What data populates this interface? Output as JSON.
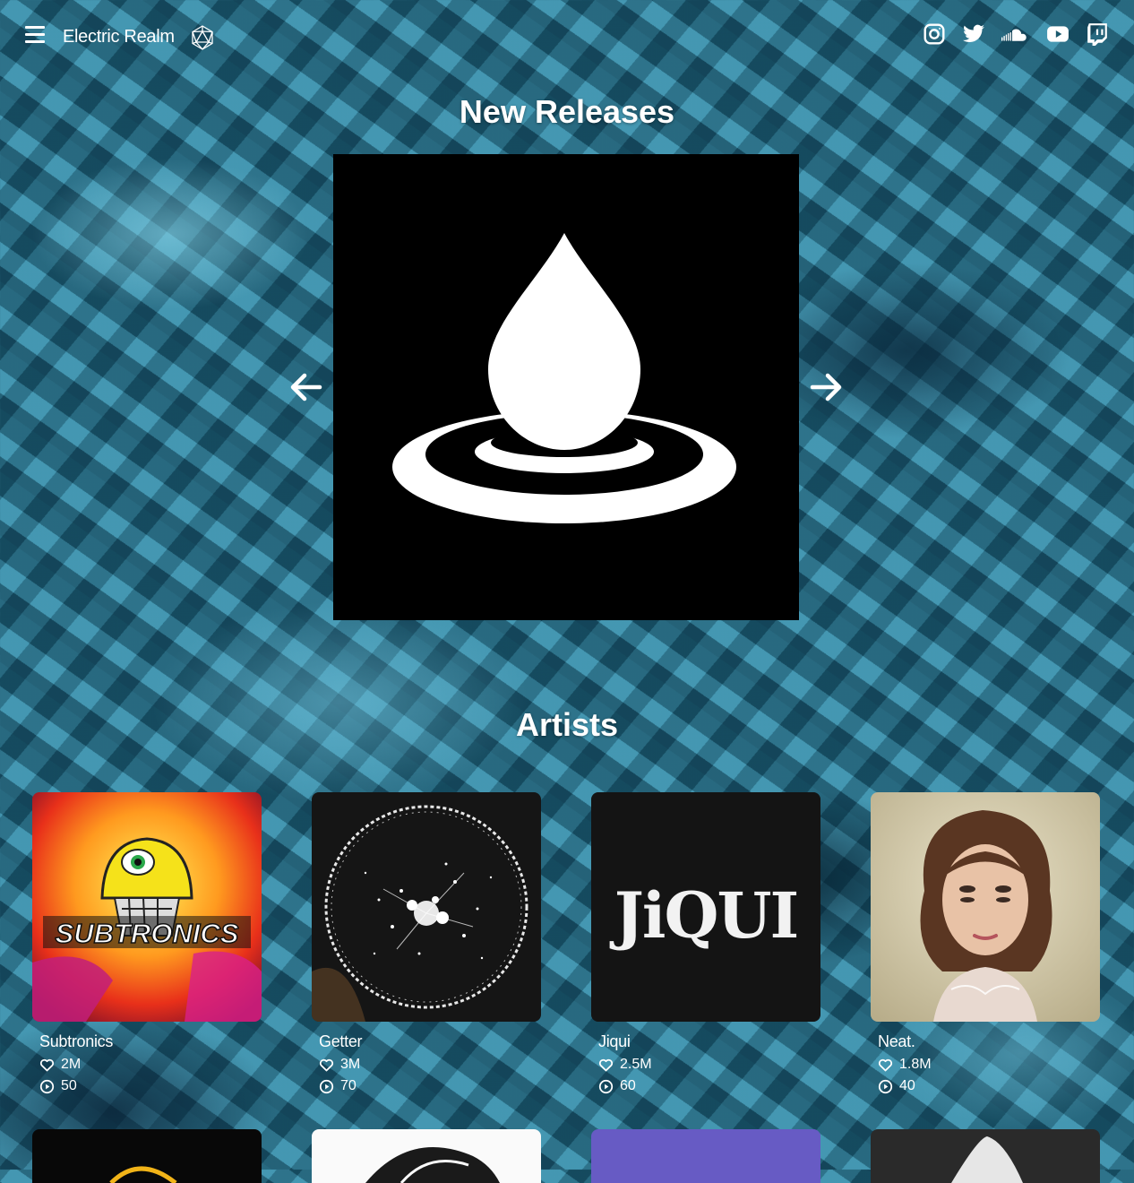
{
  "header": {
    "brand": "Electric Realm",
    "menu_icon": "hamburger-menu-icon",
    "logo_icon": "icosahedron-logo-icon",
    "socials": [
      "instagram-icon",
      "twitter-icon",
      "soundcloud-icon",
      "youtube-icon",
      "twitch-icon"
    ]
  },
  "new_releases": {
    "title": "New Releases",
    "current_cover_icon": "water-drop-icon",
    "prev_icon": "arrow-left-icon",
    "next_icon": "arrow-right-icon"
  },
  "artists": {
    "title": "Artists",
    "items": [
      {
        "name": "Subtronics",
        "likes": "2M",
        "plays": "50",
        "cover_text": "SUBTRONICS"
      },
      {
        "name": "Getter",
        "likes": "3M",
        "plays": "70"
      },
      {
        "name": "Jiqui",
        "likes": "2.5M",
        "plays": "60",
        "cover_text": "JiQUI"
      },
      {
        "name": "Neat.",
        "likes": "1.8M",
        "plays": "40"
      }
    ]
  },
  "colors": {
    "accent": "#ffffff",
    "background": "#2a7f99",
    "subtronics_yellow": "#f5e21a"
  }
}
